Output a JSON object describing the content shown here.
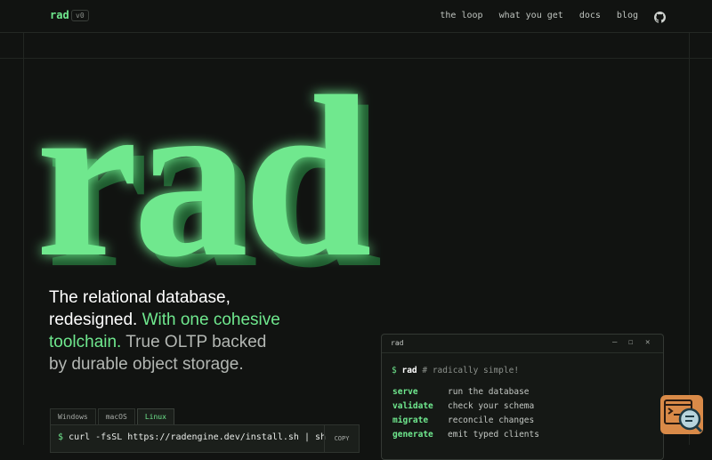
{
  "nav": {
    "logo": "rad",
    "version": "v0",
    "links": [
      "the loop",
      "what you get",
      "docs",
      "blog"
    ],
    "github_icon": "github-icon"
  },
  "hero": {
    "word": "rad",
    "color": "#6fe88e",
    "shadow_color": "#1e5a2e"
  },
  "tagline": {
    "part1": "The relational database, redesigned.",
    "part2": "With one cohesive toolchain.",
    "part3": "True OLTP backed by durable object storage."
  },
  "install": {
    "tabs": [
      "Windows",
      "macOS",
      "Linux"
    ],
    "active_tab": "Linux",
    "prompt": "$",
    "command": "curl -fsSL https://radengine.dev/install.sh | sh",
    "copy_label": "COPY"
  },
  "terminal": {
    "title": "rad",
    "controls": [
      "–",
      "☐",
      "✕"
    ],
    "prompt": "$",
    "command": "rad",
    "comment": "# radically simple!",
    "commands": [
      {
        "name": "serve",
        "desc": "run the database"
      },
      {
        "name": "validate",
        "desc": "check your schema"
      },
      {
        "name": "migrate",
        "desc": "reconcile changes"
      },
      {
        "name": "generate",
        "desc": "emit typed clients"
      }
    ]
  },
  "widget": {
    "icon": "terminal-search-icon",
    "color": "#d98a48"
  }
}
